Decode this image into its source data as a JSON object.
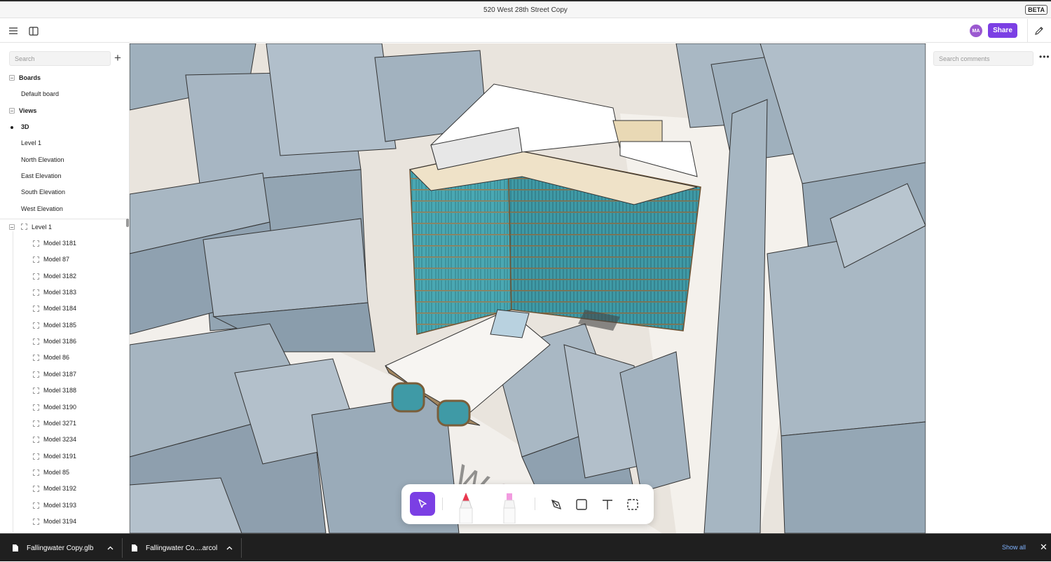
{
  "window": {
    "title": "520 West 28th Street Copy",
    "badge": "BETA"
  },
  "toolbar": {
    "avatar_initials": "MA",
    "share_label": "Share"
  },
  "sidebar": {
    "search_placeholder": "Search",
    "sections": [
      {
        "label": "Boards",
        "items": [
          "Default board"
        ]
      },
      {
        "label": "Views",
        "items": [
          "3D",
          "Level 1",
          "North Elevation",
          "East Elevation",
          "South Elevation",
          "West Elevation"
        ],
        "active": "3D"
      }
    ],
    "tree": {
      "group": "Level 1",
      "items": [
        "Model 3181",
        "Model 87",
        "Model 3182",
        "Model 3183",
        "Model 3184",
        "Model 3185",
        "Model 3186",
        "Model 86",
        "Model 3187",
        "Model 3188",
        "Model 3190",
        "Model 3271",
        "Model 3234",
        "Model 3191",
        "Model 85",
        "Model 3192",
        "Model 3193",
        "Model 3194"
      ]
    }
  },
  "comments": {
    "search_placeholder": "Search comments"
  },
  "tools": [
    "select-tool",
    "marker-tool",
    "highlighter-tool",
    "pen-tool",
    "rectangle-tool",
    "text-tool",
    "area-select-tool"
  ],
  "colors": {
    "accent": "#7b3fe4",
    "glass": "#3f9aa6",
    "frame": "#9a7b50",
    "context": "#a9b7c2",
    "ground": "#e9e4dd"
  },
  "downloads": {
    "items": [
      "Fallingwater Copy.glb",
      "Fallingwater Co....arcol"
    ],
    "show_all": "Show all"
  }
}
